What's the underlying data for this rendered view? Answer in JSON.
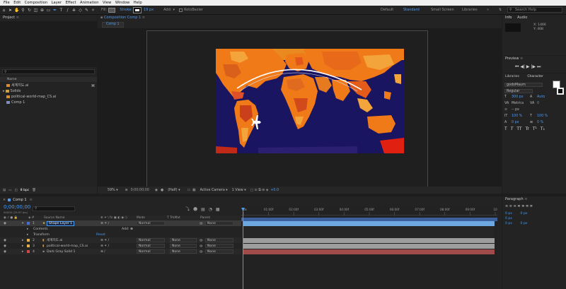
{
  "menu": [
    "File",
    "Edit",
    "Composition",
    "Layer",
    "Effect",
    "Animation",
    "View",
    "Window",
    "Help"
  ],
  "toolbar": {
    "fill_label": "Fill:",
    "stroke_label": "Stroke:",
    "stroke_px": "19 px",
    "add_label": "Add:",
    "rotobezier_label": "RotoBezier",
    "workspaces": [
      "Default",
      "Standard",
      "Small Screen",
      "Libraries"
    ],
    "active_workspace": "Standard",
    "search_placeholder": "Search Help"
  },
  "project": {
    "title": "Project",
    "search_placeholder": "",
    "column_name": "Name",
    "items": [
      {
        "label": "세계지도.ai",
        "icon": "ai-file-icon"
      },
      {
        "label": "Solids",
        "icon": "folder-icon"
      },
      {
        "label": "political-world-map_CS.ai",
        "icon": "ai-file-icon"
      },
      {
        "label": "Comp 1",
        "icon": "composition-icon"
      }
    ],
    "bpc": "8 bpc"
  },
  "composition": {
    "panel_title": "Composition Comp 1",
    "tab": "Comp 1",
    "zoom": "59%",
    "timecode": "0;00;00;00",
    "resolution": "(Half)",
    "camera": "Active Camera",
    "view": "1 View",
    "exposure": "+0.0"
  },
  "info": {
    "tabs": [
      "Info",
      "Audio"
    ],
    "x_label": "X: 1466",
    "y_label": "Y: 408"
  },
  "preview": {
    "title": "Preview"
  },
  "character": {
    "tabs": [
      "Libraries",
      "Character"
    ],
    "font": "godoMaum",
    "style": "Regular",
    "size": "300 px",
    "leading": "Auto",
    "kerning": "Metrics",
    "tracking": "0",
    "stroke_width": "-- px",
    "vscale": "100 %",
    "hscale": "100 %",
    "baseline": "0 px",
    "tsume": "0 %",
    "styles": [
      "T",
      "T",
      "TT",
      "Tr",
      "T¹",
      "T₁"
    ]
  },
  "paragraph": {
    "title": "Paragraph",
    "indent_values": [
      "0 px",
      "0 px",
      "0 px",
      "0 px",
      "0 px"
    ]
  },
  "timeline": {
    "comp_tab": "Comp 1",
    "timecode": "0;00;00;00",
    "fps": "00000 (29.97 fps)",
    "columns": {
      "source_name": "Source Name",
      "mode": "Mode",
      "trkmat": "T TrkMat",
      "parent": "Parent"
    },
    "ruler": [
      "0s",
      "01:00f",
      "02:00f",
      "03:00f",
      "04:00f",
      "05:00f",
      "06:00f",
      "07:00f",
      "08:00f",
      "09:00f",
      "10"
    ],
    "layers": [
      {
        "num": "1",
        "name": "Shape Layer 1",
        "color": "#4a6fd0",
        "mode": "Normal",
        "trkmat": "",
        "parent": "None",
        "bar": "#6ea8e0"
      },
      {
        "num": "2",
        "name": "세계지도.ai",
        "color": "#e3b04a",
        "mode": "Normal",
        "trkmat": "None",
        "parent": "None",
        "bar": "#9d9d9d"
      },
      {
        "num": "3",
        "name": "political-world-map_CS.ai",
        "color": "#e3b04a",
        "mode": "Normal",
        "trkmat": "None",
        "parent": "None",
        "bar": "#9d9d9d"
      },
      {
        "num": "4",
        "name": "Dark Gray Solid 1",
        "color": "#d04848",
        "mode": "Normal",
        "trkmat": "None",
        "parent": "None",
        "bar": "#a04a4a"
      }
    ],
    "contents_label": "Contents",
    "add_label": "Add:",
    "transform_label": "Transform",
    "reset_label": "Reset"
  },
  "colors": {
    "accent": "#4d9af0",
    "map_ocean": "#1a1560",
    "map_land": "#f07a18"
  }
}
